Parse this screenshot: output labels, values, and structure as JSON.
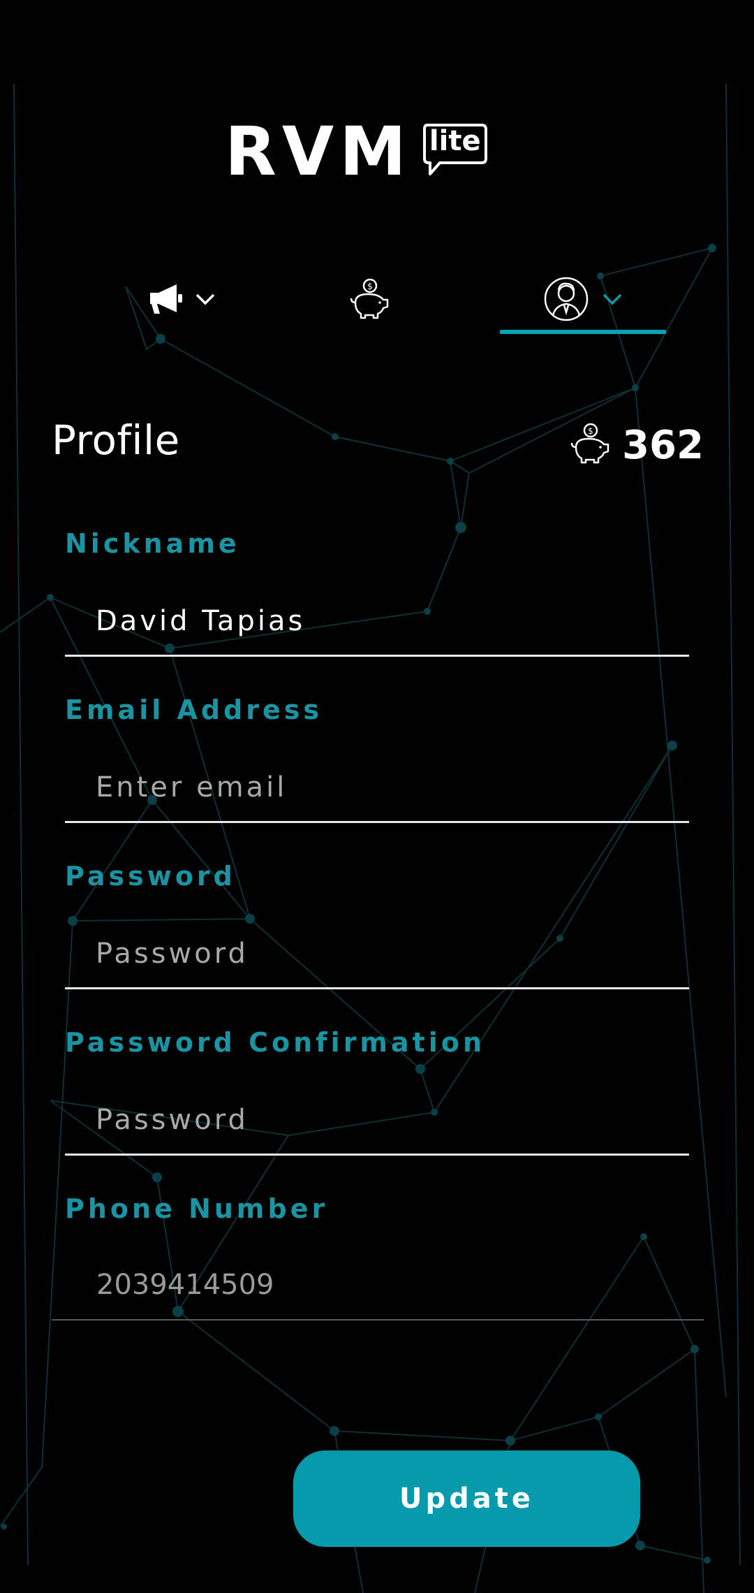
{
  "brand": {
    "name": "RVM",
    "badge": "lite",
    "accent_color": "#0aa3b5"
  },
  "tabs": [
    {
      "name": "campaigns",
      "icon": "megaphone-icon",
      "has_dropdown": true,
      "active": false
    },
    {
      "name": "savings",
      "icon": "piggy-bank-icon",
      "has_dropdown": false,
      "active": false
    },
    {
      "name": "profile",
      "icon": "user-avatar-icon",
      "has_dropdown": true,
      "active": true
    }
  ],
  "header": {
    "title": "Profile",
    "points_icon": "piggy-bank-icon",
    "points": "362"
  },
  "form": {
    "nickname": {
      "label": "Nickname",
      "value": "David Tapias"
    },
    "email": {
      "label": "Email Address",
      "placeholder": "Enter email",
      "value": ""
    },
    "password": {
      "label": "Password",
      "placeholder": "Password",
      "value": ""
    },
    "password_confirmation": {
      "label": "Password Confirmation",
      "placeholder": "Password",
      "value": ""
    },
    "phone": {
      "label": "Phone Number",
      "value": "2039414509"
    }
  },
  "actions": {
    "update_label": "Update"
  }
}
